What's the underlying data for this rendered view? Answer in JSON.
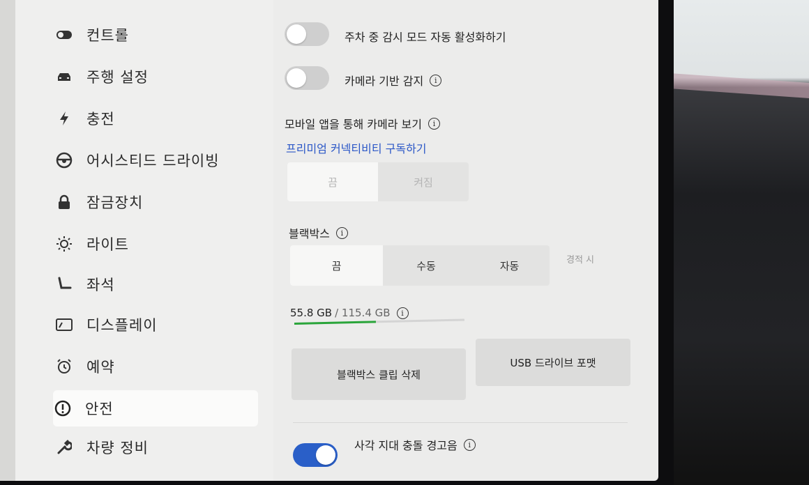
{
  "sidebar": {
    "items": [
      {
        "label": "컨트롤",
        "icon": "toggle-icon"
      },
      {
        "label": "주행 설정",
        "icon": "car-icon"
      },
      {
        "label": "충전",
        "icon": "lightning-icon"
      },
      {
        "label": "어시스티드 드라이빙",
        "icon": "steering-wheel-icon"
      },
      {
        "label": "잠금장치",
        "icon": "lock-icon"
      },
      {
        "label": "라이트",
        "icon": "sun-icon"
      },
      {
        "label": "좌석",
        "icon": "seat-icon"
      },
      {
        "label": "디스플레이",
        "icon": "display-icon"
      },
      {
        "label": "예약",
        "icon": "alarm-clock-icon"
      },
      {
        "label": "안전",
        "icon": "exclamation-circle-icon"
      },
      {
        "label": "차량 정비",
        "icon": "wrench-icon"
      }
    ],
    "active_index": 9
  },
  "safety": {
    "sentry_toggle_label": "주차 중 감시 모드 자동 활성화하기",
    "sentry_toggle_on": false,
    "camera_detect_label": "카메라 기반 감지",
    "camera_detect_on": false,
    "mobile_view_label": "모바일 앱을 통해 카메라 보기",
    "premium_link": "프리미엄 커넥티비티 구독하기",
    "mobile_view_options": [
      "끔",
      "켜짐"
    ],
    "mobile_view_selected": 0,
    "dashcam_label": "블랙박스",
    "dashcam_options": [
      "끔",
      "수동",
      "자동",
      "경적 시"
    ],
    "dashcam_selected": 0,
    "storage_used": "55.8 GB",
    "storage_total": "/ 115.4 GB",
    "storage_fraction": 0.48,
    "delete_clips_button": "블랙박스 클립 삭제",
    "format_usb_button": "USB 드라이브 포맷",
    "blind_spot_label": "사각 지대 충돌 경고음",
    "blind_spot_on": true
  },
  "colors": {
    "accent": "#2a5fc8",
    "storage_bar": "#2aa53a",
    "link": "#2b57c7"
  }
}
